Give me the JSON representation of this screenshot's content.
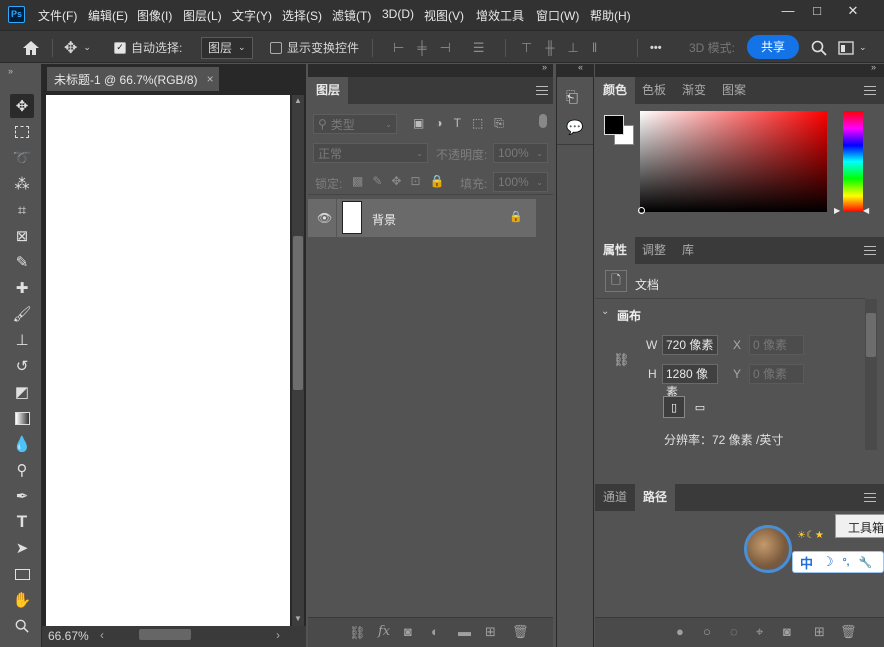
{
  "app": {
    "logo": "Ps"
  },
  "menubar": {
    "items": [
      "文件(F)",
      "编辑(E)",
      "图像(I)",
      "图层(L)",
      "文字(Y)",
      "选择(S)",
      "滤镜(T)",
      "3D(D)",
      "视图(V)",
      "增效工具",
      "窗口(W)",
      "帮助(H)"
    ],
    "window_controls": {
      "minimize": "—",
      "maximize": "□",
      "close": "✕"
    }
  },
  "options": {
    "auto_select_label": "自动选择:",
    "auto_select_checked": true,
    "auto_select_target": "图层",
    "show_transform_label": "显示变换控件",
    "more_label": "•••",
    "mode_3d_label": "3D 模式:",
    "share_label": "共享"
  },
  "document": {
    "tab_title": "未标题-1 @ 66.7%(RGB/8)",
    "tab_close": "×",
    "zoom": "66.67%"
  },
  "tools": [
    "move-tool",
    "marquee-tool",
    "lasso-tool",
    "magic-wand-tool",
    "crop-tool",
    "frame-tool",
    "eyedropper-tool",
    "healing-brush-tool",
    "brush-tool",
    "stamp-tool",
    "history-brush-tool",
    "eraser-tool",
    "gradient-tool",
    "blur-tool",
    "dodge-tool",
    "pen-tool",
    "type-tool",
    "path-select-tool",
    "rectangle-tool",
    "hand-tool",
    "zoom-tool"
  ],
  "layers_panel": {
    "tab": "图层",
    "filter_placeholder": "类型",
    "blend_mode": "正常",
    "opacity_label": "不透明度:",
    "opacity_value": "100%",
    "lock_label": "锁定:",
    "fill_label": "填充:",
    "fill_value": "100%",
    "layers": [
      {
        "name": "背景",
        "visible": true,
        "locked": true
      }
    ]
  },
  "color_panel": {
    "tabs": [
      "颜色",
      "色板",
      "渐变",
      "图案"
    ],
    "active_tab": "颜色",
    "foreground": "#000000",
    "background": "#ffffff"
  },
  "properties_panel": {
    "tabs": [
      "属性",
      "调整",
      "库"
    ],
    "active_tab": "属性",
    "doc_label": "文档",
    "section": "画布",
    "w_label": "W",
    "w_value": "720 像素",
    "h_label": "H",
    "h_value": "1280 像素",
    "x_label": "X",
    "x_placeholder": "0 像素",
    "y_label": "Y",
    "y_placeholder": "0 像素",
    "resolution": "分辨率：72 像素 /英寸"
  },
  "paths_panel": {
    "tabs": [
      "通道",
      "路径"
    ],
    "active_tab": "路径"
  },
  "tooltip": {
    "text": "工具箱"
  },
  "ime": {
    "mode": "中",
    "moon": "☽",
    "punct": "°,",
    "settings": "🔧"
  },
  "colors": {
    "accent": "#1473e6",
    "panel": "#535353",
    "dark": "#323232"
  }
}
